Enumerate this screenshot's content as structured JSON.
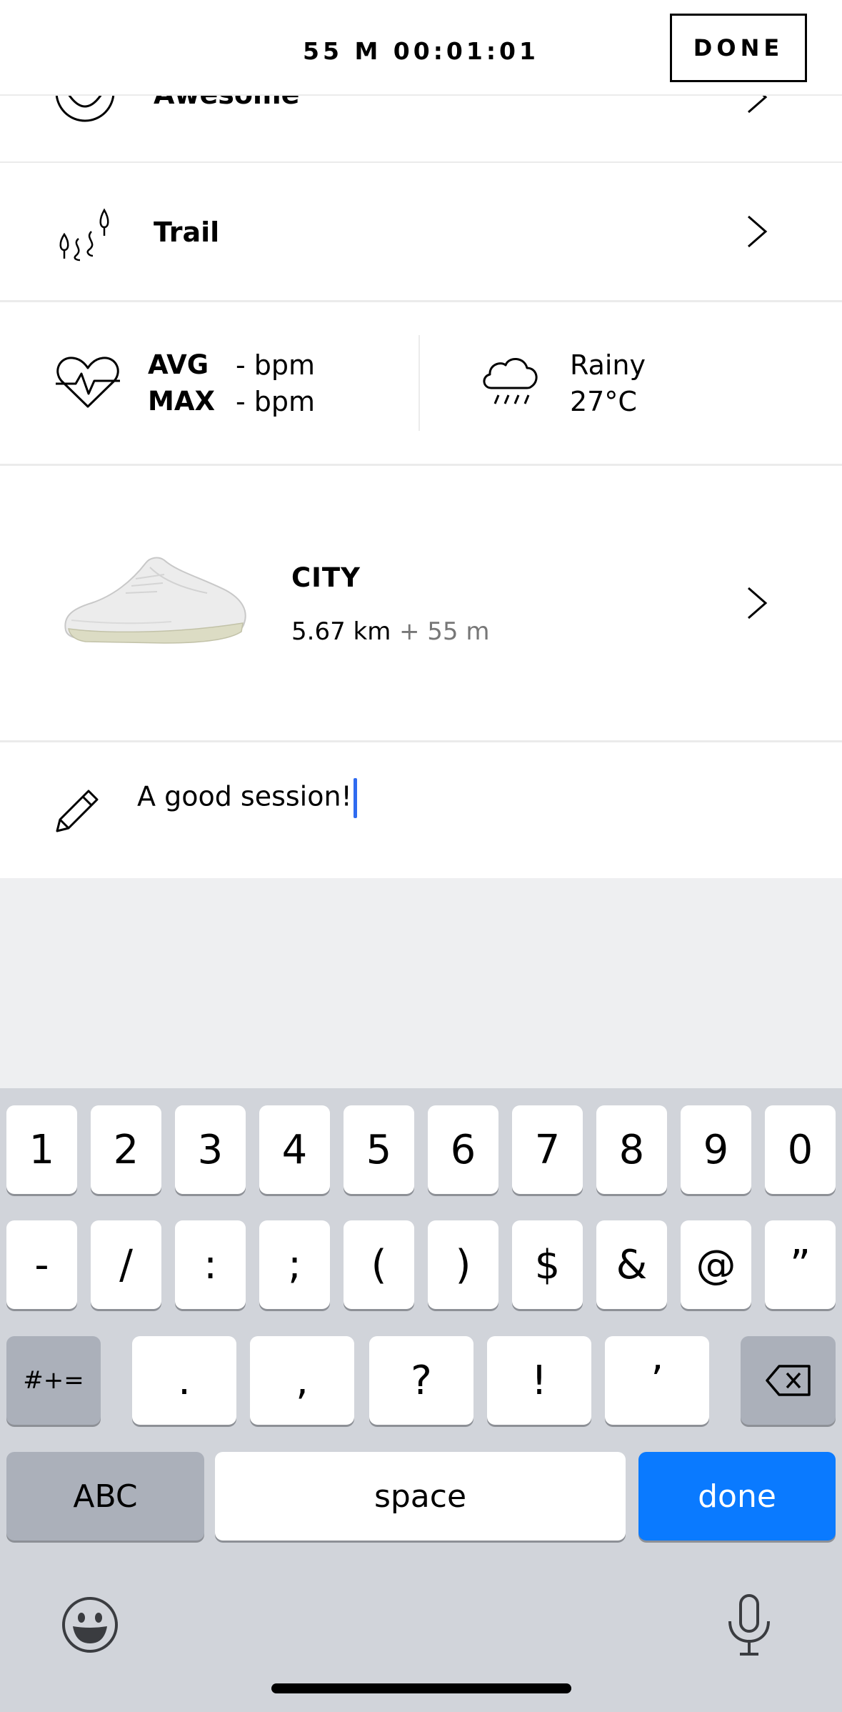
{
  "header": {
    "timer": "55 M 00:01:01",
    "done_label": "DONE"
  },
  "feeling": {
    "label": "Awesome",
    "icon": "smiley-face-icon"
  },
  "terrain": {
    "label": "Trail",
    "icon": "trail-trees-icon"
  },
  "heart_rate": {
    "icon": "heart-rate-icon",
    "avg_label": "AVG",
    "avg_value": "- bpm",
    "max_label": "MAX",
    "max_value": "- bpm"
  },
  "weather": {
    "icon": "rain-cloud-icon",
    "condition": "Rainy",
    "temperature": "27°C"
  },
  "shoe": {
    "name": "CITY",
    "distance": "5.67 km",
    "extra": "+ 55 m"
  },
  "note": {
    "icon": "pencil-icon",
    "text": "A good session!"
  },
  "keyboard": {
    "row1": [
      "1",
      "2",
      "3",
      "4",
      "5",
      "6",
      "7",
      "8",
      "9",
      "0"
    ],
    "row2": [
      "-",
      "/",
      ":",
      ";",
      "(",
      ")",
      "$",
      "&",
      "@",
      "”"
    ],
    "row3": {
      "symbols": "#+=",
      "keys": [
        ".",
        ",",
        "?",
        "!",
        "’"
      ]
    },
    "row4": {
      "abc": "ABC",
      "space": "space",
      "done": "done"
    },
    "colors": {
      "done_key": "#0a7aff",
      "caret": "#2f6bf0"
    }
  }
}
